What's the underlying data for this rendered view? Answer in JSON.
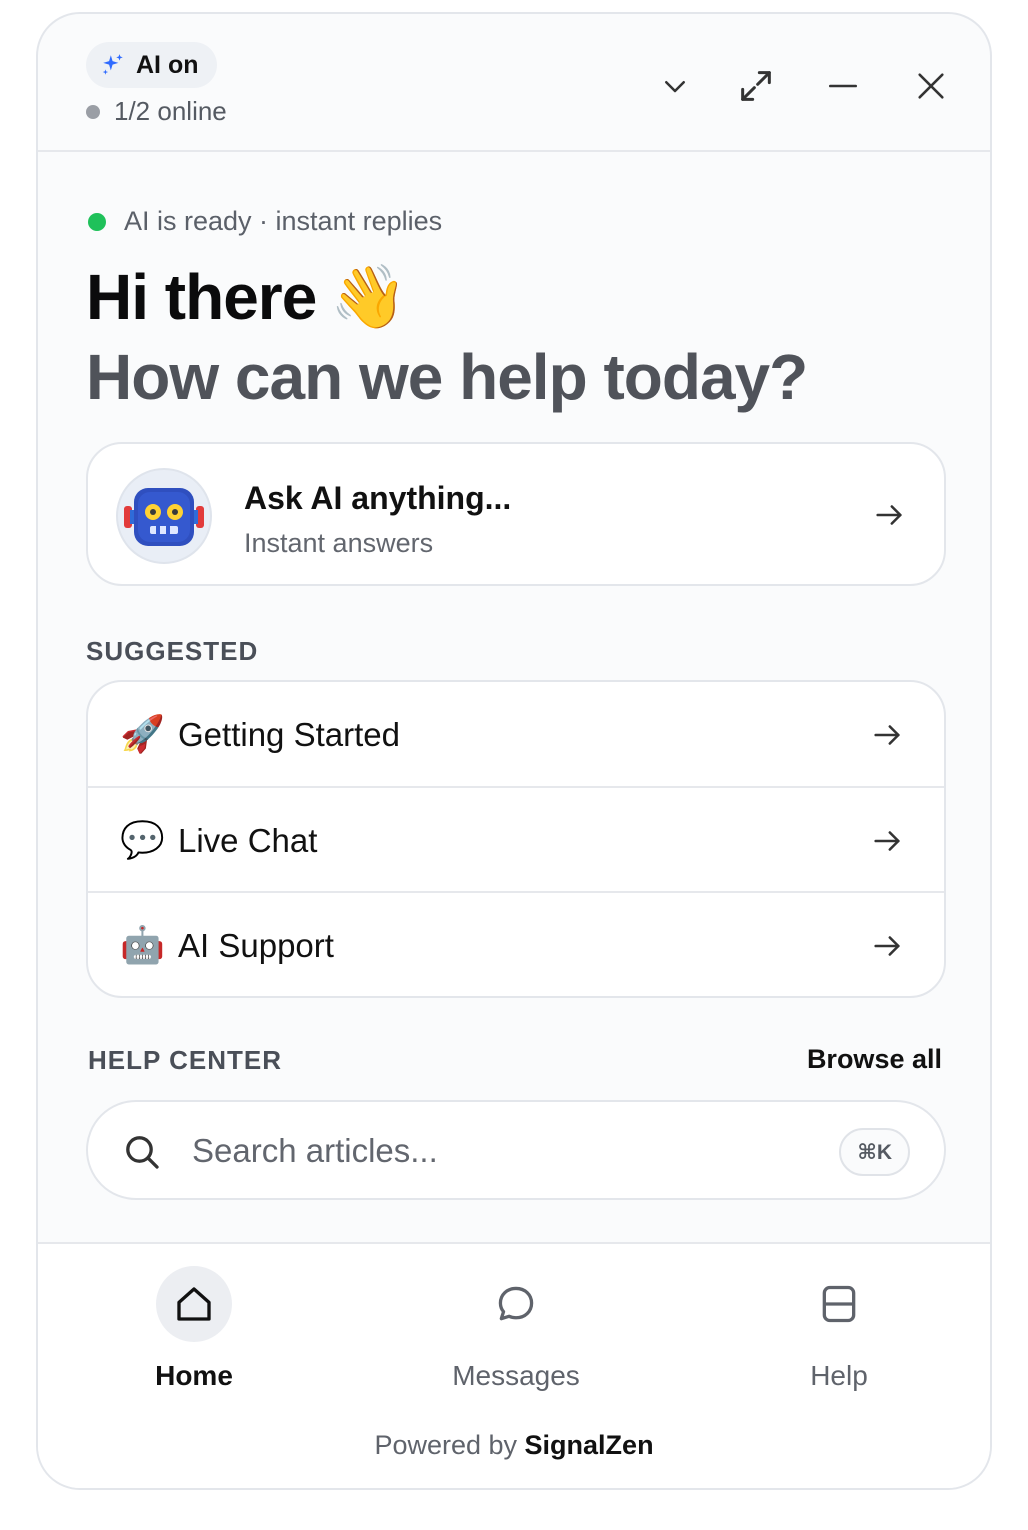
{
  "header": {
    "ai_badge": "AI on",
    "online_status": "1/2 online",
    "actions": {
      "collapse": "chevron-down-icon",
      "expand": "expand-icon",
      "minimize": "minus-icon",
      "close": "close-icon"
    }
  },
  "greeting": {
    "status": "AI is ready · instant replies",
    "title": "Hi there",
    "wave_emoji": "👋",
    "subtitle": "How can we help today?"
  },
  "ask_ai": {
    "title": "Ask AI anything...",
    "subtitle": "Instant answers",
    "avatar_icon": "robot-icon"
  },
  "suggested": {
    "label": "SUGGESTED",
    "items": [
      {
        "emoji": "🚀",
        "label": "Getting Started"
      },
      {
        "emoji": "💬",
        "label": "Live Chat"
      },
      {
        "emoji": "🤖",
        "label": "AI Support"
      }
    ]
  },
  "help_center": {
    "label": "HELP CENTER",
    "browse_all": "Browse all",
    "search_placeholder": "Search articles...",
    "shortcut": "⌘K"
  },
  "nav": {
    "items": [
      {
        "label": "Home",
        "icon": "home-icon",
        "active": true
      },
      {
        "label": "Messages",
        "icon": "chat-bubble-icon",
        "active": false
      },
      {
        "label": "Help",
        "icon": "help-book-icon",
        "active": false
      }
    ],
    "powered_prefix": "Powered by",
    "powered_brand": "SignalZen"
  },
  "colors": {
    "ready_dot": "#1fc15a",
    "ai_sparkle": "#2f6bff",
    "panel_bg": "#fafbfc",
    "border": "#e3e6eb"
  }
}
